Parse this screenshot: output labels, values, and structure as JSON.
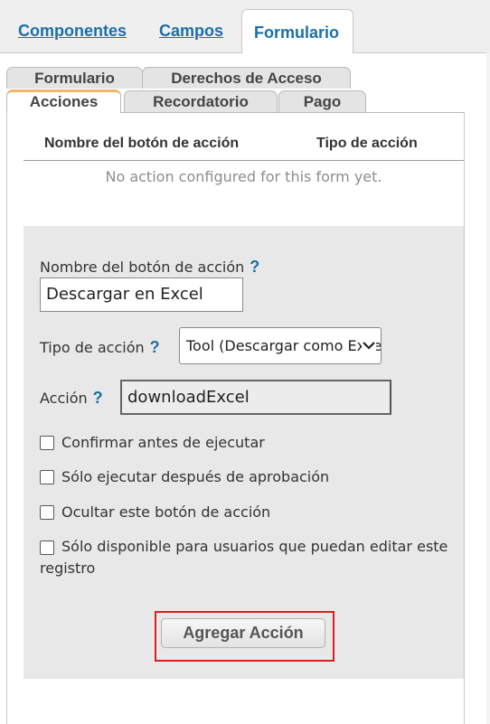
{
  "top_tabs": [
    {
      "label": "Componentes"
    },
    {
      "label": "Campos"
    },
    {
      "label": "Formulario"
    }
  ],
  "sub_tabs": [
    {
      "label": "Formulario"
    },
    {
      "label": "Derechos de Acceso"
    },
    {
      "label": "Acciones"
    },
    {
      "label": "Recordatorio"
    },
    {
      "label": "Pago"
    }
  ],
  "table": {
    "headers": [
      "Nombre del botón de acción",
      "Tipo de acción"
    ],
    "empty_message": "No action configured for this form yet."
  },
  "form": {
    "name_label": "Nombre del botón de acción",
    "name_value": "Descargar en Excel",
    "type_label": "Tipo de acción",
    "type_value": "Tool (Descargar como Excel)",
    "action_label": "Acción",
    "action_value": "downloadExcel",
    "help_glyph": "?",
    "checkboxes": [
      {
        "label": "Confirmar antes de ejecutar",
        "checked": false
      },
      {
        "label": "Sólo ejecutar después de aprobación",
        "checked": false
      },
      {
        "label": "Ocultar este botón de acción",
        "checked": false
      },
      {
        "label": "Sólo disponible para usuarios que puedan editar este registro",
        "checked": false
      }
    ],
    "submit_label": "Agregar Acción"
  },
  "colors": {
    "link": "#1a6fa8",
    "active_subtab_accent": "#f0b66a",
    "highlight": "#d82020"
  }
}
